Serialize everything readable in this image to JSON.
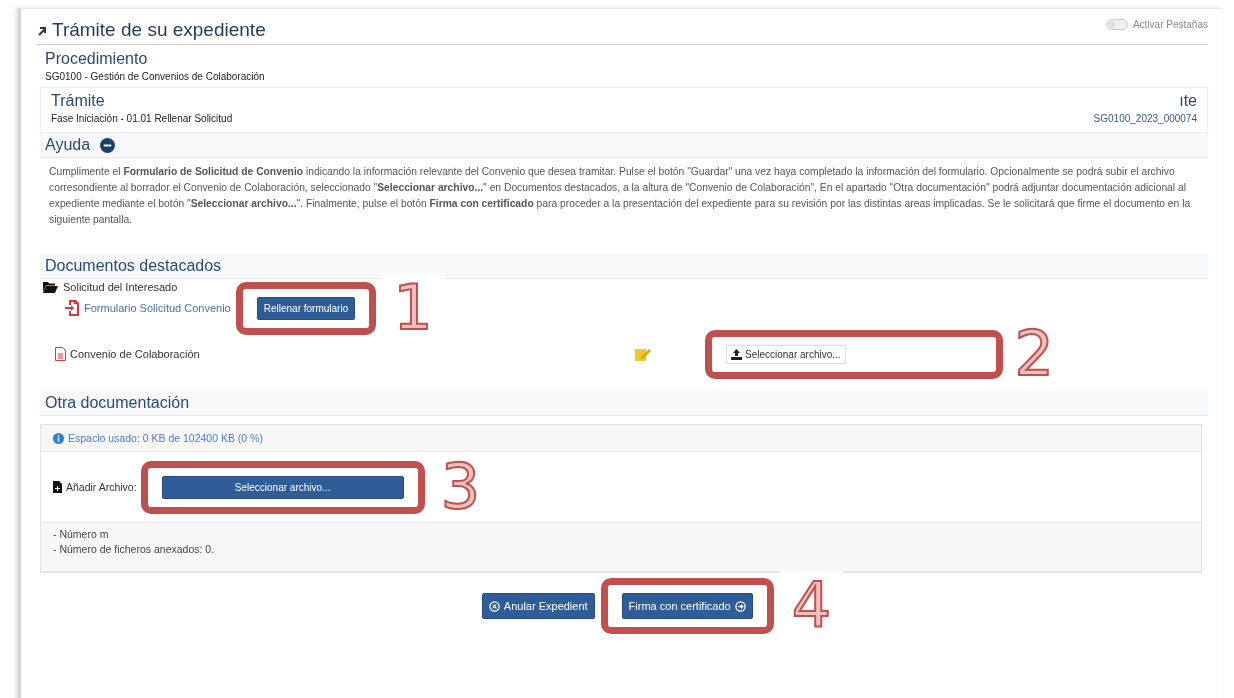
{
  "header": {
    "title": "Trámite de su expediente",
    "toggle": {
      "label": "Activar Pestañas",
      "on": false
    }
  },
  "procedimiento": {
    "title": "Procedimiento",
    "value": "SG0100 - Gestión de Convenios de Colaboración"
  },
  "tramite": {
    "title": "Trámite",
    "value": "Fase Iniciación - 01.01 Rellenar Solicitud",
    "right_title": "ıte",
    "right_value": "SG0100_2023_000074"
  },
  "help": {
    "title": "Ayuda",
    "expanded": true,
    "text": "Cumplimente el **Formulario de Solicitud de Convenio** indicando la información relevante del Convenio que desea tramitar. Pulse el botón \"Guardar\" una vez haya completado la información del formulario. Opcionalmente se podrá subir el archivo corresondiente al borrador el Convenio de Colaboración, seleccionado \"**Seleccionar archivo...**\" en Documentos destacados, a la altura de \"Convenio de Colaboración\", En el apartado \"Otra documentación\" podrá adjuntar documentación adicional al expediente mediante el botón \"**Seleccionar archivo...**\". Finalmente, pulse el botón **Firma con certificado** para proceder a la presentación del expediente para su revisión por las distintas areas implicadas. Se le solicitará que firme el documento en la siguiente pantalla."
  },
  "featured_docs": {
    "title": "Documentos destacados",
    "folder": "Solicitud del Interesado",
    "items": [
      {
        "kind": "form",
        "label": "Formulario Solicitud Convenio",
        "button": "Rellenar formulario",
        "callout": "1"
      },
      {
        "kind": "upload",
        "label": "Convenio de Colaboración",
        "button": "Seleccionar archivo...",
        "callout": "2"
      }
    ]
  },
  "other_docs": {
    "title": "Otra documentación",
    "space": "Espacio usado:  0 KB de 102400 KB (0 %)",
    "add_label": "Añadir Archivo:",
    "button": "Seleccionar archivo...",
    "callout": "3",
    "notes": [
      "- Número m",
      "- Número de ficheros anexados: 0."
    ]
  },
  "actions": [
    {
      "kind": "cancel",
      "label": "Anular Expedient"
    },
    {
      "kind": "sign",
      "label": "Firma con certificado",
      "callout": "4"
    }
  ]
}
